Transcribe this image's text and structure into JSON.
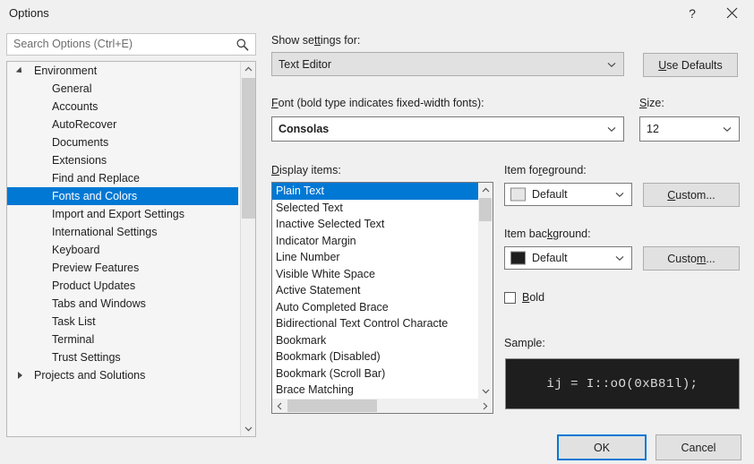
{
  "window": {
    "title": "Options",
    "help_label": "?",
    "close_label": "×"
  },
  "search": {
    "placeholder": "Search Options (Ctrl+E)",
    "value": "",
    "icon": "search-icon"
  },
  "tree": {
    "nodes": [
      {
        "label": "Environment",
        "level": 0,
        "state": "expanded",
        "selected": false
      },
      {
        "label": "General",
        "level": 1,
        "state": "leaf",
        "selected": false
      },
      {
        "label": "Accounts",
        "level": 1,
        "state": "leaf",
        "selected": false
      },
      {
        "label": "AutoRecover",
        "level": 1,
        "state": "leaf",
        "selected": false
      },
      {
        "label": "Documents",
        "level": 1,
        "state": "leaf",
        "selected": false
      },
      {
        "label": "Extensions",
        "level": 1,
        "state": "leaf",
        "selected": false
      },
      {
        "label": "Find and Replace",
        "level": 1,
        "state": "leaf",
        "selected": false
      },
      {
        "label": "Fonts and Colors",
        "level": 1,
        "state": "leaf",
        "selected": true
      },
      {
        "label": "Import and Export Settings",
        "level": 1,
        "state": "leaf",
        "selected": false
      },
      {
        "label": "International Settings",
        "level": 1,
        "state": "leaf",
        "selected": false
      },
      {
        "label": "Keyboard",
        "level": 1,
        "state": "leaf",
        "selected": false
      },
      {
        "label": "Preview Features",
        "level": 1,
        "state": "leaf",
        "selected": false
      },
      {
        "label": "Product Updates",
        "level": 1,
        "state": "leaf",
        "selected": false
      },
      {
        "label": "Tabs and Windows",
        "level": 1,
        "state": "leaf",
        "selected": false
      },
      {
        "label": "Task List",
        "level": 1,
        "state": "leaf",
        "selected": false
      },
      {
        "label": "Terminal",
        "level": 1,
        "state": "leaf",
        "selected": false
      },
      {
        "label": "Trust Settings",
        "level": 1,
        "state": "leaf",
        "selected": false
      },
      {
        "label": "Projects and Solutions",
        "level": 0,
        "state": "collapsed",
        "selected": false
      }
    ],
    "selected_label": "Fonts and Colors"
  },
  "main": {
    "show_settings_label": "Show settings for:",
    "show_settings_value": "Text Editor",
    "use_defaults_label": "Use Defaults",
    "font_label": "Font (bold type indicates fixed-width fonts):",
    "font_value": "Consolas",
    "size_label": "Size:",
    "size_value": "12",
    "display_items_label": "Display items:",
    "display_items": [
      "Plain Text",
      "Selected Text",
      "Inactive Selected Text",
      "Indicator Margin",
      "Line Number",
      "Visible White Space",
      "Active Statement",
      "Auto Completed Brace",
      "Bidirectional Text Control Characte",
      "Bookmark",
      "Bookmark (Disabled)",
      "Bookmark (Scroll Bar)",
      "Brace Matching"
    ],
    "display_items_selected": "Plain Text",
    "item_foreground_label": "Item foreground:",
    "item_foreground_value": "Default",
    "item_foreground_swatch": "#E6E6E6",
    "item_background_label": "Item background:",
    "item_background_value": "Default",
    "item_background_swatch": "#1E1E1E",
    "custom_fg_label": "Custom...",
    "custom_bg_label": "Custom...",
    "bold_label": "Bold",
    "bold_checked": false,
    "sample_label": "Sample:",
    "sample_text": "ij = I::oO(0xB81l);",
    "sample_background": "#1E1E1E",
    "sample_foreground": "#DCDCDC"
  },
  "footer": {
    "ok_label": "OK",
    "cancel_label": "Cancel"
  },
  "colors": {
    "accent": "#0078D4",
    "dialog_bg": "#F0F0F0",
    "field_bg": "#FFFFFF"
  }
}
